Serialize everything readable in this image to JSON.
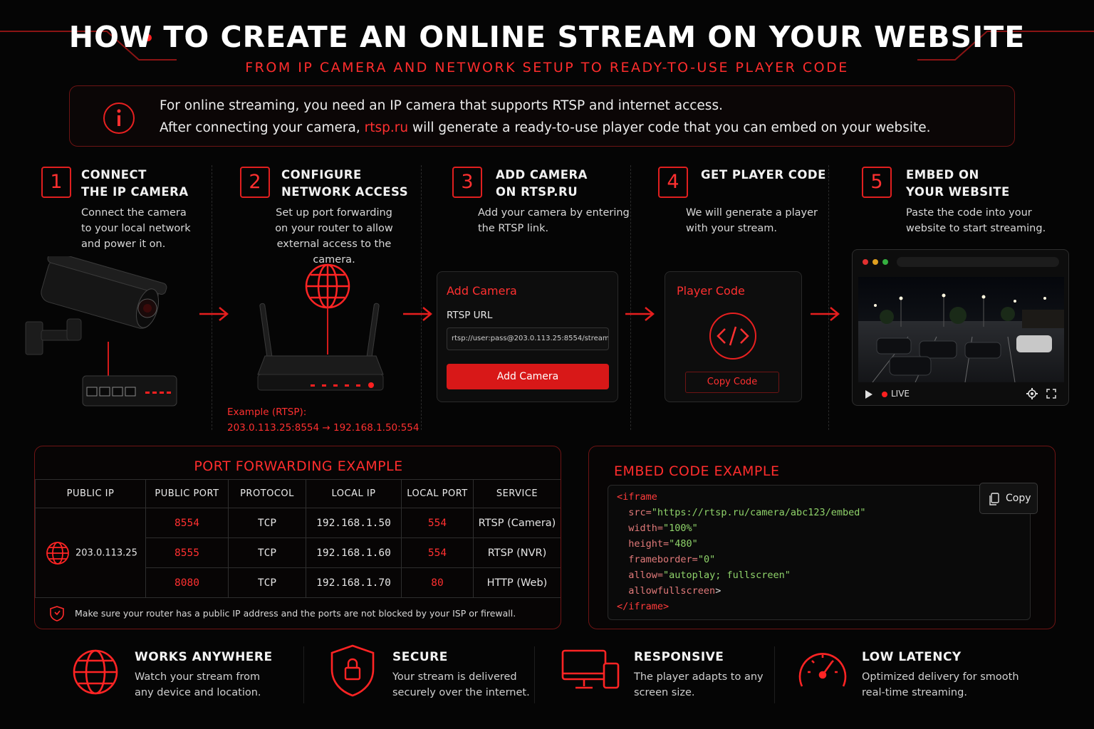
{
  "header": {
    "title": "HOW TO CREATE AN ONLINE STREAM ON YOUR WEBSITE",
    "subtitle": "FROM IP CAMERA AND NETWORK SETUP TO READY-TO-USE PLAYER CODE"
  },
  "info": {
    "icon": "info-icon",
    "line1": "For online streaming, you need an IP camera that supports RTSP and internet access.",
    "line2_pre": "After connecting your camera, ",
    "line2_link": "rtsp.ru",
    "line2_post": " will generate a ready-to-use player code that you can embed on your website."
  },
  "steps": [
    {
      "num": "1",
      "title1": "CONNECT",
      "title2": "THE IP CAMERA",
      "desc": [
        "Connect the camera",
        "to your local network",
        "and power it on."
      ]
    },
    {
      "num": "2",
      "title1": "CONFIGURE",
      "title2": "NETWORK ACCESS",
      "desc": [
        "Set up port forwarding",
        "on your router to allow",
        "external access to the camera."
      ]
    },
    {
      "num": "3",
      "title1": "ADD CAMERA",
      "title2": "ON RTSP.RU",
      "desc": [
        "Add your camera by entering",
        "the RTSP link."
      ]
    },
    {
      "num": "4",
      "title1": "GET PLAYER CODE",
      "title2": "",
      "desc": [
        "We will generate a player",
        "with your stream."
      ]
    },
    {
      "num": "5",
      "title1": "EMBED ON",
      "title2": "YOUR WEBSITE",
      "desc": [
        "Paste the code into your",
        "website to start streaming."
      ]
    }
  ],
  "router_example": {
    "label": "Example (RTSP):",
    "mapping": "203.0.113.25:8554 → 192.168.1.50:554"
  },
  "add_camera_card": {
    "title": "Add Camera",
    "field_label": "RTSP URL",
    "field_value": "rtsp://user:pass@203.0.113.25:8554/stream",
    "button": "Add Camera"
  },
  "player_code_card": {
    "title": "Player Code",
    "button": "Copy Code"
  },
  "browser_player": {
    "live_label": "LIVE"
  },
  "port_forwarding": {
    "title": "PORT FORWARDING EXAMPLE",
    "columns": [
      "PUBLIC IP",
      "PUBLIC PORT",
      "PROTOCOL",
      "LOCAL IP",
      "LOCAL PORT",
      "SERVICE"
    ],
    "public_ip": "203.0.113.25",
    "rows": [
      {
        "public_port": "8554",
        "protocol": "TCP",
        "local_ip": "192.168.1.50",
        "local_port": "554",
        "service": "RTSP (Camera)"
      },
      {
        "public_port": "8555",
        "protocol": "TCP",
        "local_ip": "192.168.1.60",
        "local_port": "554",
        "service": "RTSP (NVR)"
      },
      {
        "public_port": "8080",
        "protocol": "TCP",
        "local_ip": "192.168.1.70",
        "local_port": "80",
        "service": "HTTP (Web)"
      }
    ],
    "note": "Make sure your router has a public IP address and the ports are not blocked by your ISP or firewall."
  },
  "embed_code": {
    "title": "EMBED CODE EXAMPLE",
    "copy_label": "Copy",
    "open_tag": "<iframe",
    "src_attr": "src=",
    "src_val": "\"https://rtsp.ru/camera/abc123/embed\"",
    "width_attr": "width=",
    "width_val": "\"100%\"",
    "height_attr": "height=",
    "height_val": "\"480\"",
    "fb_attr": "frameborder=",
    "fb_val": "\"0\"",
    "allow_attr": "allow=",
    "allow_val": "\"autoplay; fullscreen\"",
    "allowfs": "allowfullscreen",
    "close_angle": ">",
    "close_tag": "</iframe>",
    "close_tag_end": ">"
  },
  "features": [
    {
      "icon": "globe-icon",
      "title": "WORKS ANYWHERE",
      "desc": [
        "Watch your stream from",
        "any device and location."
      ]
    },
    {
      "icon": "shield-lock-icon",
      "title": "SECURE",
      "desc": [
        "Your stream is delivered",
        "securely over the internet."
      ]
    },
    {
      "icon": "devices-icon",
      "title": "RESPONSIVE",
      "desc": [
        "The player adapts to any",
        "screen size."
      ]
    },
    {
      "icon": "speedometer-icon",
      "title": "LOW LATENCY",
      "desc": [
        "Optimized delivery for smooth",
        "real-time streaming."
      ]
    }
  ],
  "colors": {
    "accent": "#ff2d2d",
    "panel_border": "#6e1414",
    "background": "#050505"
  }
}
